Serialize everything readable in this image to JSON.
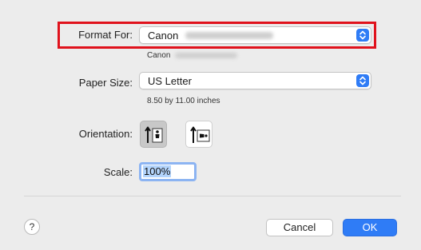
{
  "format_for": {
    "label": "Format For:",
    "value": "Canon",
    "sub_text": "Canon"
  },
  "paper_size": {
    "label": "Paper Size:",
    "value": "US Letter",
    "sub_text": "8.50 by 11.00 inches"
  },
  "orientation": {
    "label": "Orientation:",
    "options": [
      "portrait",
      "landscape"
    ],
    "selected": "portrait"
  },
  "scale": {
    "label": "Scale:",
    "value": "100%"
  },
  "buttons": {
    "help": "?",
    "cancel": "Cancel",
    "ok": "OK"
  },
  "colors": {
    "accent": "#2f7cf6",
    "highlight_border": "#e0121c",
    "background": "#ececec"
  }
}
